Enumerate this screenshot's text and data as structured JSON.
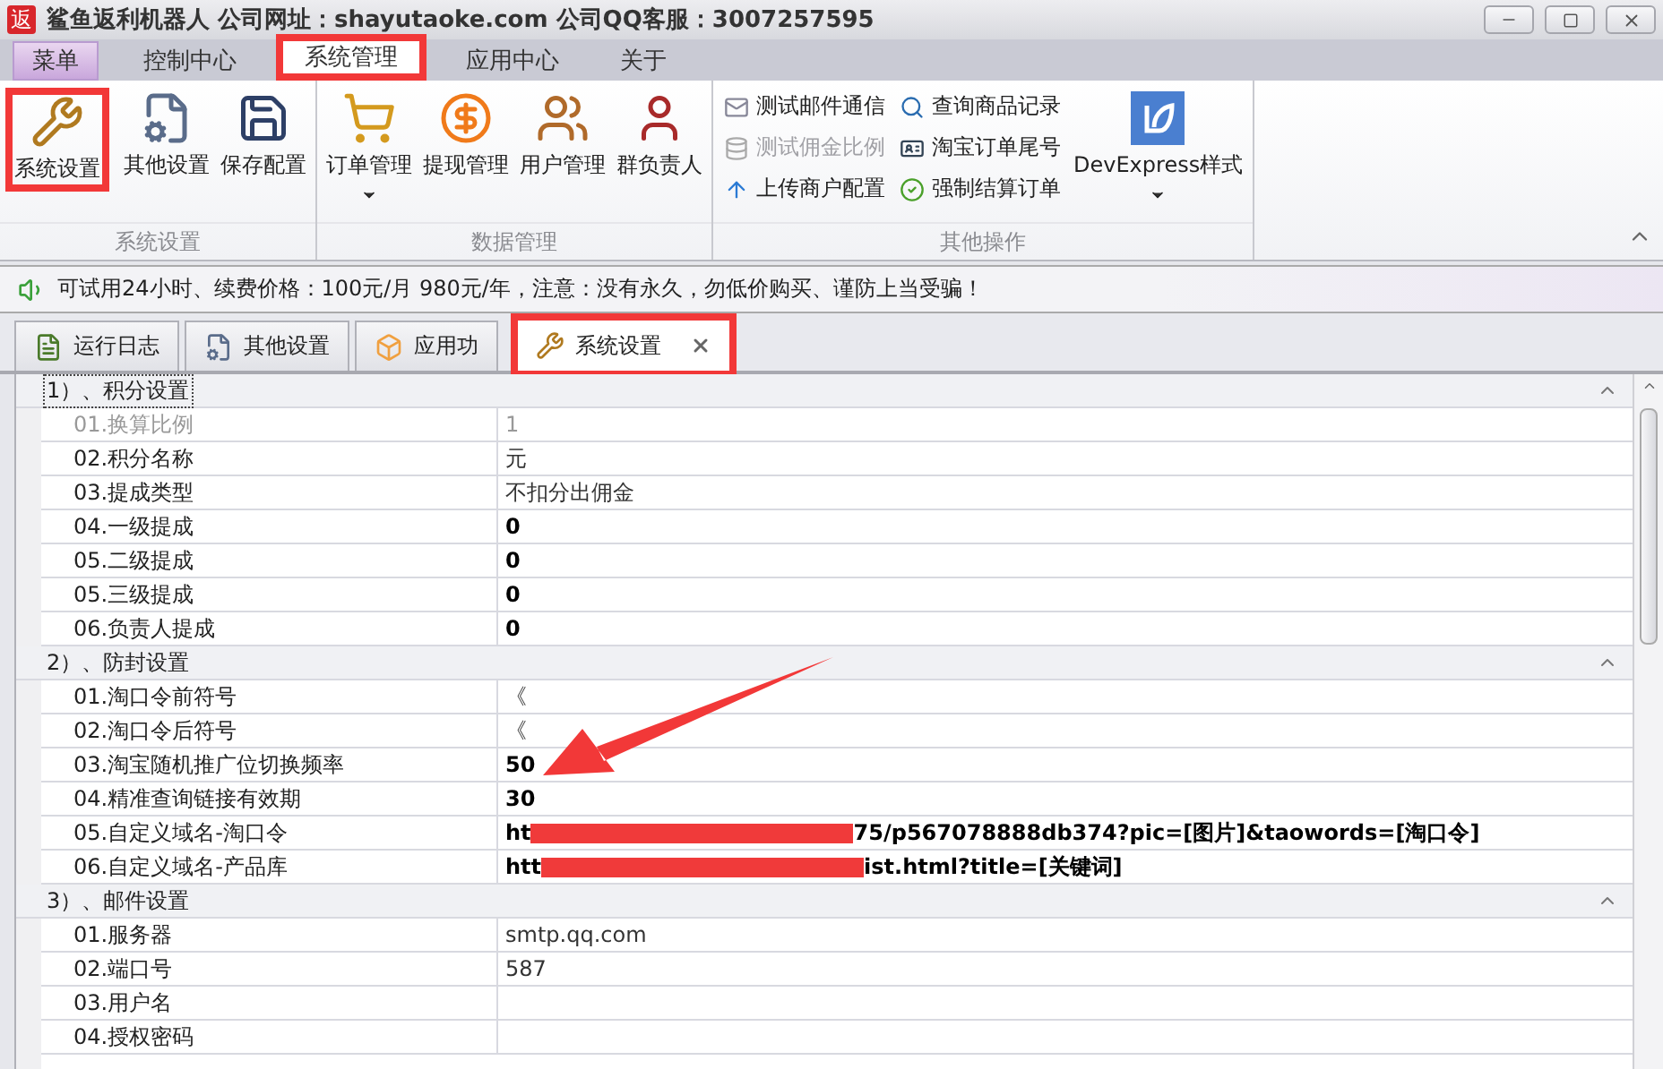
{
  "window": {
    "logo": "返",
    "title": "鲨鱼返利机器人  公司网址：shayutaoke.com 公司QQ客服：3007257595"
  },
  "ribbon_tabs": [
    {
      "label": "菜单",
      "kind": "app"
    },
    {
      "label": "控制中心",
      "kind": "tab",
      "selected": false,
      "highlighted": false
    },
    {
      "label": "系统管理",
      "kind": "tab",
      "selected": true,
      "highlighted": true
    },
    {
      "label": "应用中心",
      "kind": "tab",
      "selected": false,
      "highlighted": false
    },
    {
      "label": "关于",
      "kind": "tab",
      "selected": false,
      "highlighted": false
    }
  ],
  "ribbon_groups": [
    {
      "title": "系统设置",
      "items": [
        {
          "label": "系统设置",
          "kind": "large",
          "dropdown": false,
          "highlighted": true
        },
        {
          "label": "其他设置",
          "kind": "large",
          "dropdown": false
        },
        {
          "label": "保存配置",
          "kind": "large",
          "dropdown": false
        }
      ]
    },
    {
      "title": "数据管理",
      "items": [
        {
          "label": "订单管理",
          "kind": "large",
          "dropdown": true
        },
        {
          "label": "提现管理",
          "kind": "large",
          "dropdown": false
        },
        {
          "label": "用户管理",
          "kind": "large",
          "dropdown": false
        },
        {
          "label": "群负责人",
          "kind": "large",
          "dropdown": false
        }
      ]
    },
    {
      "title": "其他操作",
      "items": [
        {
          "label": "测试邮件通信",
          "kind": "small",
          "disabled": false
        },
        {
          "label": "测试佣金比例",
          "kind": "small",
          "disabled": true
        },
        {
          "label": "上传商户配置",
          "kind": "small",
          "disabled": false
        },
        {
          "label": "查询商品记录",
          "kind": "small",
          "disabled": false
        },
        {
          "label": "淘宝订单尾号",
          "kind": "small",
          "disabled": false
        },
        {
          "label": "强制结算订单",
          "kind": "small",
          "disabled": false
        },
        {
          "label": "DevExpress样式",
          "kind": "large",
          "dropdown": true
        }
      ]
    }
  ],
  "notice": "可试用24小时、续费价格：100元/月  980元/年，注意：没有永久，勿低价购买、谨防上当受骗！",
  "doc_tabs": [
    {
      "label": "运行日志",
      "selected": false,
      "highlighted": false
    },
    {
      "label": "其他设置",
      "selected": false,
      "highlighted": false
    },
    {
      "label": "应用功",
      "selected": false,
      "highlighted": false
    },
    {
      "label": "系统设置",
      "selected": true,
      "highlighted": true
    }
  ],
  "grid": {
    "categories": [
      {
        "title": "1）、积分设置",
        "expanded": true,
        "focused": true,
        "rows": [
          {
            "name": "01.换算比例",
            "value": "1",
            "kind": "text",
            "disabled": true,
            "bold": false
          },
          {
            "name": "02.积分名称",
            "value": "元",
            "kind": "text",
            "disabled": false,
            "bold": false
          },
          {
            "name": "03.提成类型",
            "value": "不扣分出佣金",
            "kind": "text",
            "disabled": false,
            "bold": false
          },
          {
            "name": "04.一级提成",
            "value": "0",
            "kind": "text",
            "disabled": false,
            "bold": true
          },
          {
            "name": "05.二级提成",
            "value": "0",
            "kind": "text",
            "disabled": false,
            "bold": true
          },
          {
            "name": "05.三级提成",
            "value": "0",
            "kind": "text",
            "disabled": false,
            "bold": true
          },
          {
            "name": "06.负责人提成",
            "value": "0",
            "kind": "text",
            "disabled": false,
            "bold": true
          }
        ]
      },
      {
        "title": "2）、防封设置",
        "expanded": true,
        "focused": false,
        "rows": [
          {
            "name": "01.淘口令前符号",
            "value": "《",
            "kind": "text",
            "disabled": false,
            "bold": false
          },
          {
            "name": "02.淘口令后符号",
            "value": "《",
            "kind": "text",
            "disabled": false,
            "bold": false
          },
          {
            "name": "03.淘宝随机推广位切换频率",
            "value": "50",
            "kind": "text",
            "disabled": false,
            "bold": true
          },
          {
            "name": "04.精准查询链接有效期",
            "value": "30",
            "kind": "text",
            "disabled": false,
            "bold": true
          },
          {
            "name": "05.自定义域名-淘口令",
            "value_start": "ht",
            "value_end": "75/p567078888db374?pic=[图片]&taowords=[淘口令]",
            "kind": "redacted",
            "disabled": false,
            "bold": true
          },
          {
            "name": "06.自定义域名-产品库",
            "value_start": "htt",
            "value_end": "ist.html?title=[关键词]",
            "kind": "redacted",
            "disabled": false,
            "bold": true
          }
        ]
      },
      {
        "title": "3）、邮件设置",
        "expanded": true,
        "focused": false,
        "rows": [
          {
            "name": "01.服务器",
            "value": "smtp.qq.com",
            "kind": "text",
            "disabled": false,
            "bold": false
          },
          {
            "name": "02.端口号",
            "value": "587",
            "kind": "text",
            "disabled": false,
            "bold": false
          },
          {
            "name": "03.用户名",
            "kind": "text",
            "disabled": false
          },
          {
            "name": "04.授权密码",
            "kind": "text",
            "disabled": false
          }
        ]
      }
    ]
  }
}
